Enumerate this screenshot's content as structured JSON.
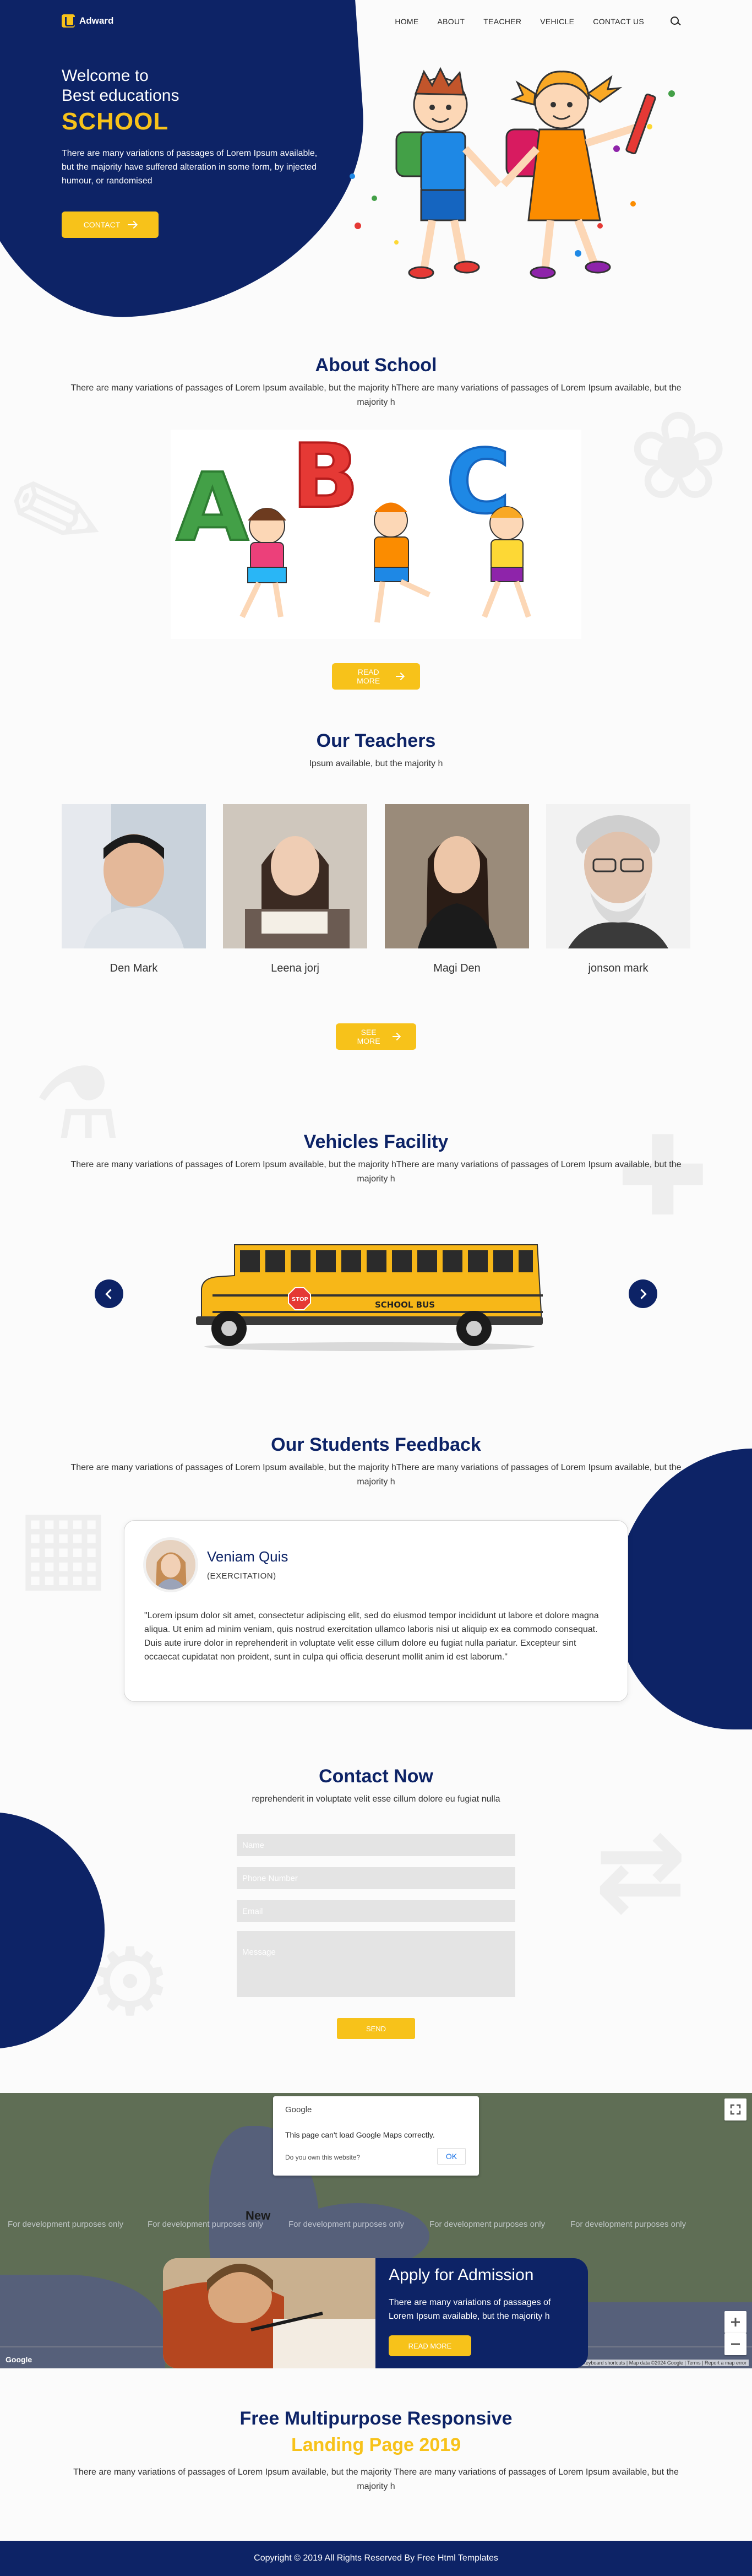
{
  "brand": {
    "name": "Adward"
  },
  "nav": {
    "items": [
      "HOME",
      "ABOUT",
      "TEACHER",
      "VEHICLE",
      "CONTACT US"
    ]
  },
  "hero": {
    "welcome_line1": "Welcome to",
    "welcome_line2": "Best educations",
    "headline": "SCHOOL",
    "description": "There are many variations of passages of Lorem Ipsum available, but the majority have suffered alteration in some form, by injected humour, or randomised",
    "button": "CONTACT"
  },
  "about": {
    "title": "About School",
    "text": "There are many variations of passages of Lorem Ipsum available, but the majority hThere are many variations of passages of Lorem Ipsum available, but the majority h",
    "button": "READ MORE",
    "letters": [
      "A",
      "B",
      "C"
    ]
  },
  "teachers": {
    "title": "Our Teachers",
    "subtitle": "Ipsum available, but the majority h",
    "list": [
      {
        "name": "Den Mark"
      },
      {
        "name": "Leena jorj"
      },
      {
        "name": "Magi Den"
      },
      {
        "name": "jonson mark"
      }
    ],
    "button": "SEE MORE"
  },
  "vehicles": {
    "title": "Vehicles Facility",
    "text": "There are many variations of passages of Lorem Ipsum available, but the majority hThere are many variations of passages of Lorem Ipsum available, but the majority h",
    "bus_label": "SCHOOL BUS",
    "stop_label": "STOP"
  },
  "feedback": {
    "title": "Our Students Feedback",
    "text": "There are many variations of passages of Lorem Ipsum available, but the majority hThere are many variations of passages of Lorem Ipsum available, but the majority h",
    "name": "Veniam Quis",
    "role": "(EXERCITATION)",
    "quote": "\"Lorem ipsum dolor sit amet, consectetur adipiscing elit, sed do eiusmod tempor incididunt ut labore et dolore magna aliqua. Ut enim ad minim veniam, quis nostrud exercitation ullamco laboris nisi ut aliquip ex ea commodo consequat. Duis aute irure dolor in reprehenderit in voluptate velit esse cillum dolore eu fugiat nulla pariatur. Excepteur sint occaecat cupidatat non proident, sunt in culpa qui officia deserunt mollit anim id est laborum.\""
  },
  "contact": {
    "title": "Contact Now",
    "subtitle": "reprehenderit in voluptate velit esse cillum dolore eu fugiat nulla",
    "name_placeholder": "Name",
    "phone_placeholder": "Phone Number",
    "email_placeholder": "Email",
    "message_placeholder": "Message",
    "send": "SEND"
  },
  "map": {
    "dialog_brand": "Google",
    "dialog_message": "This page can't load Google Maps correctly.",
    "dialog_question": "Do you own this website?",
    "dialog_ok": "OK",
    "dev_watermark": "For development purposes only",
    "city_label": "New",
    "attribution": "Keyboard shortcuts | Map data ©2024 Google | Terms | Report a map error"
  },
  "admission": {
    "title": "Apply for Admission",
    "text": "There are many variations of passages of Lorem Ipsum available, but the majority h",
    "button": "READ MORE"
  },
  "footer": {
    "title_line1": "Free Multipurpose Responsive",
    "title_line2": "Landing Page 2019",
    "text": "There are many variations of passages of Lorem Ipsum available, but the majority There are many variations of passages of Lorem Ipsum available, but the majority h",
    "copyright": "Copyright © 2019 All Rights Reserved By Free Html Templates"
  },
  "colors": {
    "navy": "#0d2366",
    "accent_yellow": "#f7c21a"
  }
}
